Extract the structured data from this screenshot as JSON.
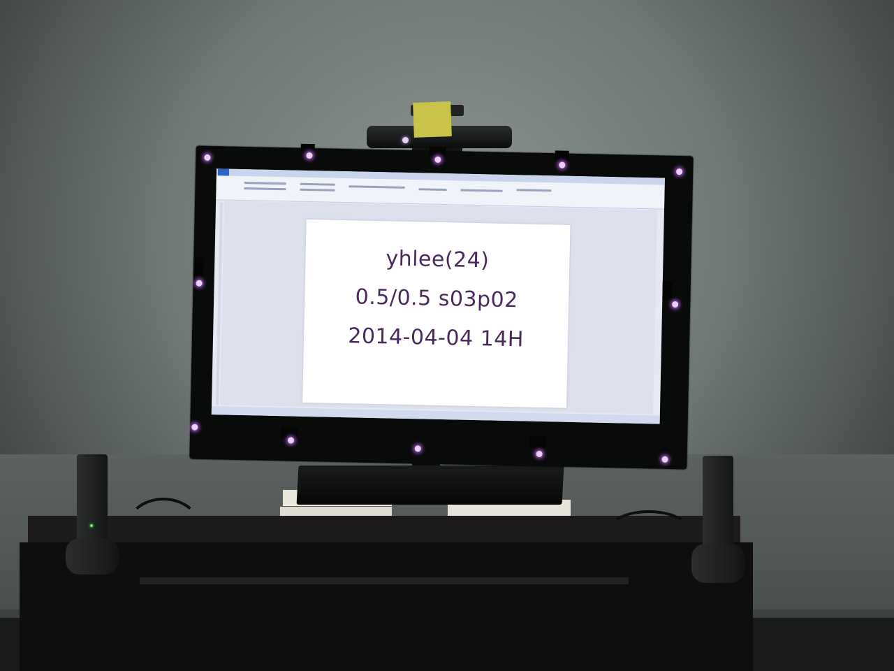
{
  "screen_page": {
    "lines": [
      "yhlee(24)",
      "0.5/0.5  s03p02",
      "2014-04-04  14H"
    ]
  },
  "colors": {
    "marker": "#b05ad8",
    "page_text": "#4a2a5c",
    "sticky_note": "#c9c34a",
    "power_led": "#5cff6a"
  }
}
